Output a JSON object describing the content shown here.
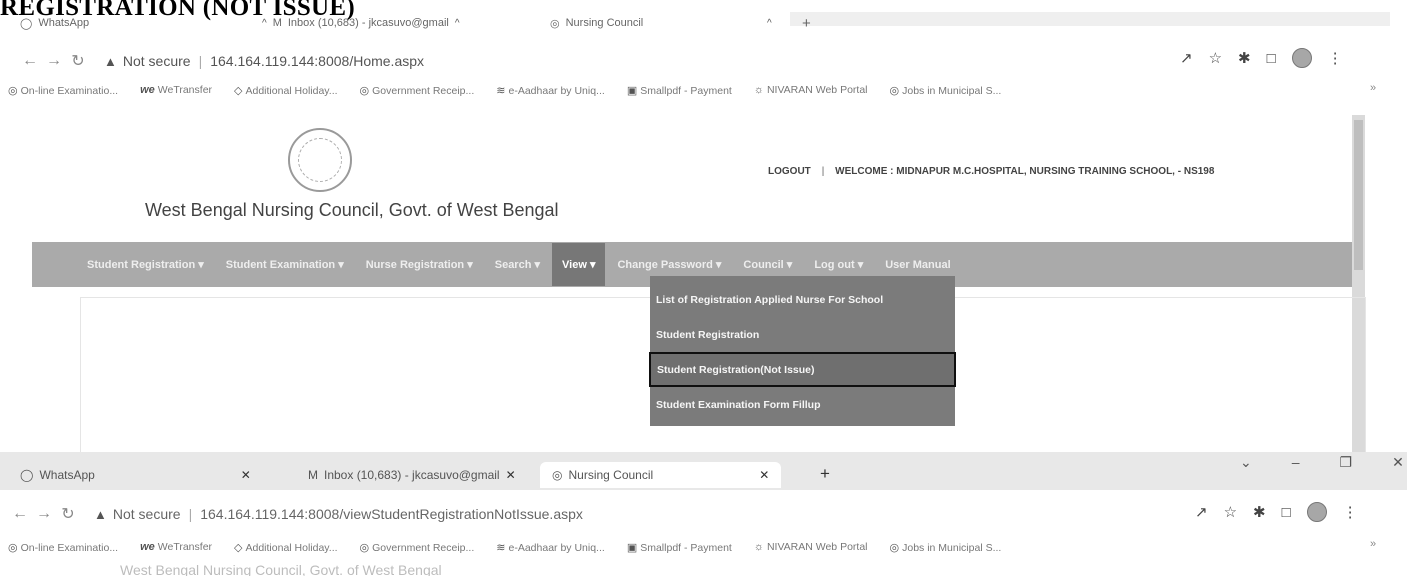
{
  "document_heading": "REGISTRATION (NOT ISSUE)",
  "top_window": {
    "tabs": [
      {
        "label": "WhatsApp",
        "icon": "whatsapp-icon"
      },
      {
        "label": "Inbox (10,683) - jkcasuvo@gmail",
        "icon": "gmail-icon"
      },
      {
        "label": "Nursing Council",
        "icon": "globe-icon"
      }
    ],
    "address": {
      "security_label": "Not secure",
      "url": "164.164.119.144:8008/Home.aspx"
    },
    "bookmarks": [
      "On-line Examinatio...",
      "WeTransfer",
      "Additional Holiday...",
      "Government Receip...",
      "e-Aadhaar by Uniq...",
      "Smallpdf - Payment",
      "NIVARAN Web Portal",
      "Jobs in Municipal S..."
    ]
  },
  "page": {
    "council_title": "West Bengal Nursing Council, Govt. of West Bengal",
    "logout_link": "LOGOUT",
    "welcome_text": "WELCOME : MIDNAPUR M.C.HOSPITAL, NURSING TRAINING SCHOOL, - NS198",
    "nav_items": [
      "Student Registration ▾",
      "Student Examination ▾",
      "Nurse Registration ▾",
      "Search ▾",
      "View ▾",
      "Change Password ▾",
      "Council ▾",
      "Log out ▾",
      "User Manual"
    ],
    "active_nav_index": 4,
    "view_dropdown": [
      "List of Registration Applied Nurse For School",
      "Student Registration",
      "Student Registration(Not Issue)",
      "Student Examination Form Fillup"
    ],
    "highlighted_dropdown_index": 2
  },
  "bottom_window": {
    "tabs": [
      {
        "label": "WhatsApp",
        "icon": "whatsapp-icon"
      },
      {
        "label": "Inbox (10,683) - jkcasuvo@gmail",
        "icon": "gmail-icon"
      },
      {
        "label": "Nursing Council",
        "icon": "globe-icon"
      }
    ],
    "new_tab_symbol": "+",
    "address": {
      "security_label": "Not secure",
      "url": "164.164.119.144:8008/viewStudentRegistrationNotIssue.aspx"
    },
    "bookmarks": [
      "On-line Examinatio...",
      "WeTransfer",
      "Additional Holiday...",
      "Government Receip...",
      "e-Aadhaar by Uniq...",
      "Smallpdf - Payment",
      "NIVARAN Web Portal",
      "Jobs in Municipal S..."
    ]
  }
}
